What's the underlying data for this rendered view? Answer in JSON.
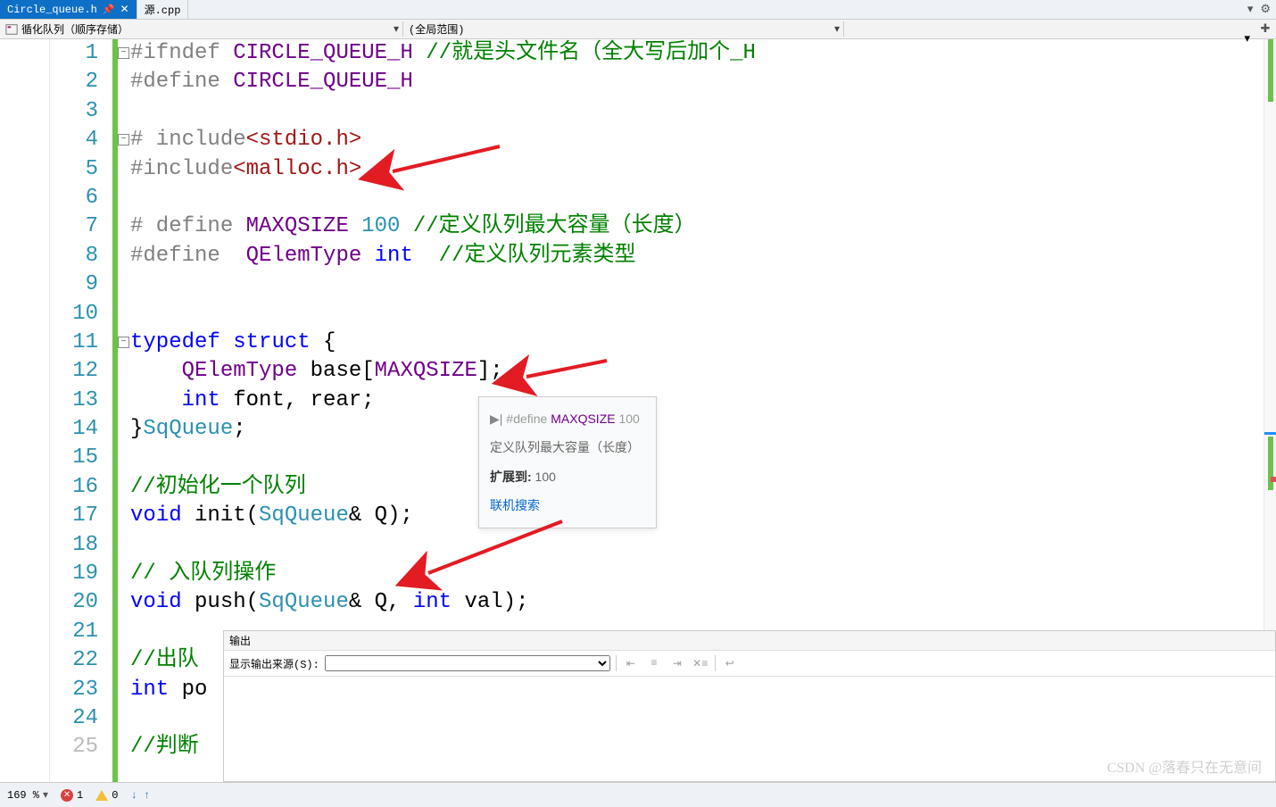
{
  "tabs": {
    "active": "Circle_queue.h",
    "inactive": "源.cpp"
  },
  "nav": {
    "scope1": "循化队列（顺序存储）",
    "scope2": "(全局范围)"
  },
  "code": {
    "l1_pre": "#ifndef ",
    "l1_macro": "CIRCLE_QUEUE_H",
    "l1_comment": " //就是头文件名（全大写后加个_H",
    "l2_pre": "#define ",
    "l2_macro": "CIRCLE_QUEUE_H",
    "l4_pre": "# include",
    "l4_hdr": "<stdio.h>",
    "l5_pre": "#include",
    "l5_hdr": "<malloc.h>",
    "l7_pre": "# define ",
    "l7_macro": "MAXQSIZE",
    "l7_val": " 100 ",
    "l7_comment": "//定义队列最大容量（长度）",
    "l8_pre": "#define  ",
    "l8_macro": "QElemType",
    "l8_val": " int  ",
    "l8_comment": "//定义队列元素类型",
    "l11_typedef": "typedef",
    "l11_struct": " struct ",
    "l11_brace": "{",
    "l12_type": "QElemType",
    "l12_rest": " base[",
    "l12_macro": "MAXQSIZE",
    "l12_end": "];",
    "l13_int": "int",
    "l13_rest": " font, rear;",
    "l14_brace": "}",
    "l14_name": "SqQueue",
    "l14_semi": ";",
    "l16_comment": "//初始化一个队列",
    "l17_void": "void",
    "l17_fn": " init(",
    "l17_type": "SqQueue",
    "l17_rest": "& Q);",
    "l19_comment": "// 入队列操作",
    "l20_void": "void",
    "l20_fn": " push(",
    "l20_type": "SqQueue",
    "l20_mid": "& Q, ",
    "l20_int": "int",
    "l20_rest": " val);",
    "l22_comment": "//出队",
    "l23_int": "int",
    "l23_rest": " po",
    "l25_comment": "//判断"
  },
  "tooltip": {
    "def_pre": "#define ",
    "def_macro": "MAXQSIZE",
    "def_val": " 100",
    "line2": "定义队列最大容量（长度）",
    "line3_label": "扩展到:",
    "line3_val": " 100",
    "link": "联机搜索"
  },
  "output": {
    "title": "输出",
    "source_label": "显示输出来源(S):"
  },
  "status": {
    "zoom": "169 %",
    "errors": "1",
    "warnings": "0"
  },
  "watermark": "CSDN @落春只在无意间"
}
